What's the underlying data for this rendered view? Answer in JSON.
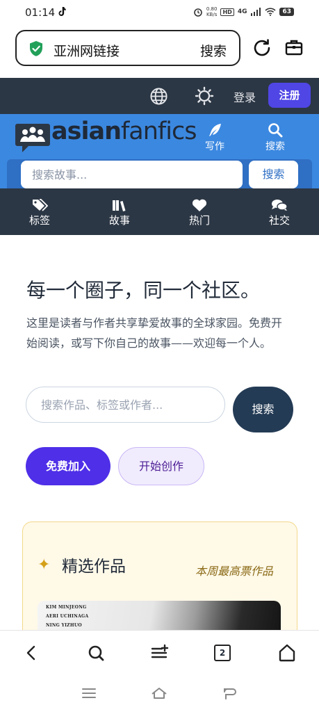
{
  "status_bar": {
    "time": "01:14",
    "speed_value": "0.80",
    "speed_unit": "KB/s",
    "hd": "HD",
    "network": "4G",
    "battery": "63"
  },
  "browser": {
    "url_text": "亚洲网链接",
    "url_search_label": "搜索",
    "tab_count": "2"
  },
  "site": {
    "login_label": "登录",
    "register_label": "注册",
    "logo_asian": "asian",
    "logo_fanfics": "fanfics",
    "write_label": "写作",
    "search_nav_label": "搜索",
    "search_placeholder": "搜索故事...",
    "search_button": "搜索",
    "nav": [
      {
        "label": "标签",
        "icon": "tags-icon"
      },
      {
        "label": "故事",
        "icon": "books-icon"
      },
      {
        "label": "热门",
        "icon": "heart-icon"
      },
      {
        "label": "社交",
        "icon": "comments-icon"
      }
    ]
  },
  "hero": {
    "title": "每一个圈子，同一个社区。",
    "description": "这里是读者与作者共享挚爱故事的全球家园。免费开始阅读，或写下你自己的故事——欢迎每一个人。",
    "search_placeholder": "搜索作品、标签或作者...",
    "search_button": "搜索",
    "join_button": "免费加入",
    "create_button": "开始创作"
  },
  "featured": {
    "title": "精选作品",
    "subtitle": "本周最高票作品",
    "cover_names": [
      "KIM MINJEONG",
      "AERI UCHINAGA",
      "NING YIZHUO"
    ]
  },
  "colors": {
    "site_dark": "#2c3745",
    "brand_blue": "#3b88e0",
    "accent_purple": "#4f46e5",
    "featured_bg": "#fff9e8"
  }
}
